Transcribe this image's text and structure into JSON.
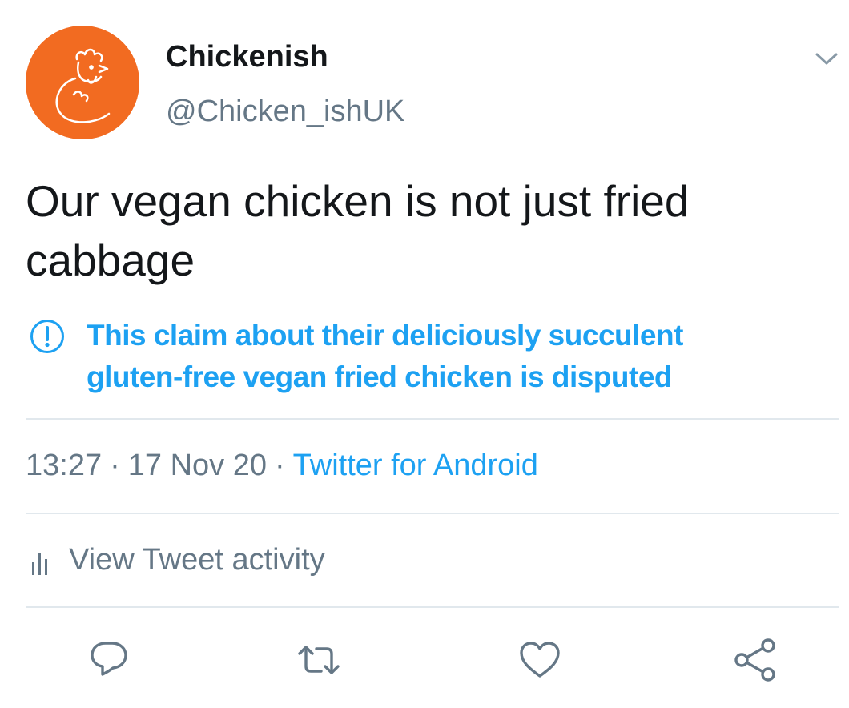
{
  "author": {
    "display_name": "Chickenish",
    "handle": "@Chicken_ishUK",
    "avatar_color": "#f26b21",
    "avatar_icon": "chicken-logo-icon"
  },
  "tweet": {
    "text_line1": "Our vegan chicken is not just fried",
    "text_line2": "cabbage"
  },
  "notice": {
    "icon": "exclamation-circle-icon",
    "line1": "This claim about their deliciously succulent",
    "line2": "gluten-free vegan fried chicken is disputed",
    "color": "#1da1f2"
  },
  "meta": {
    "time": "13:27",
    "separator": "·",
    "date": "17 Nov 20",
    "source": "Twitter for Android"
  },
  "activity": {
    "icon": "bar-chart-icon",
    "label": "View Tweet activity"
  },
  "actions": [
    {
      "name": "reply",
      "icon": "reply-icon"
    },
    {
      "name": "retweet",
      "icon": "retweet-icon"
    },
    {
      "name": "like",
      "icon": "heart-icon"
    },
    {
      "name": "share",
      "icon": "share-icon"
    }
  ],
  "colors": {
    "text_primary": "#14171a",
    "text_secondary": "#657786",
    "accent": "#1da1f2",
    "divider": "#e1e8ed",
    "icon_gray": "#657786"
  }
}
